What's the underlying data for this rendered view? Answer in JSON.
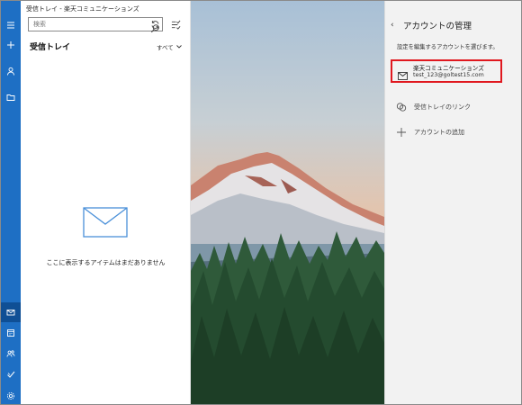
{
  "window": {
    "title": "受信トレイ - 楽天コミュニケーションズ",
    "controls": {
      "minimize": "—",
      "maximize": "☐",
      "close": "✕"
    }
  },
  "rail": {
    "top_icons": [
      "hamburger-icon",
      "compose-icon",
      "person-icon",
      "folder-icon"
    ],
    "bottom_icons": [
      "mail-icon",
      "calendar-icon",
      "people-icon",
      "todo-icon",
      "settings-icon"
    ]
  },
  "list_pane": {
    "search_placeholder": "検索",
    "folder_title": "受信トレイ",
    "filter_label": "すべて",
    "empty_message": "ここに表示するアイテムはまだありません"
  },
  "account_panel": {
    "title": "アカウントの管理",
    "description": "設定を編集するアカウントを選びます。",
    "accounts": [
      {
        "name": "楽天コミュニケーションズ",
        "email": "test_123@goltest15.com"
      }
    ],
    "options": [
      {
        "label": "受信トレイのリンク",
        "icon": "link-icon"
      },
      {
        "label": "アカウントの追加",
        "icon": "plus-icon"
      }
    ]
  },
  "colors": {
    "rail": "#1e6fc4",
    "highlight_border": "#e0181f",
    "panel_bg": "#f2f2f2"
  }
}
